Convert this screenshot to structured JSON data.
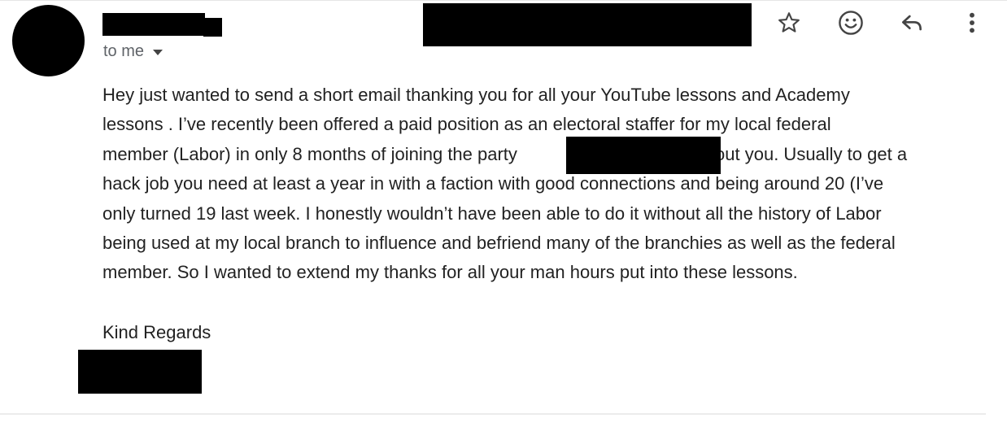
{
  "header": {
    "recipient_label": "to me"
  },
  "toolbar": {
    "star_icon": "star-outline",
    "emoji_icon": "add-reaction-smiley",
    "reply_icon": "reply-arrow",
    "more_icon": "vertical-ellipsis"
  },
  "message": {
    "line1": "Hey just wanted to send a short email thanking you for all your YouTube lessons and Academy",
    "line2": "lessons . I’ve recently been offered a paid position as an electoral staffer for my local federal",
    "line3a": "member (Labor) in only 8 months of joining the party",
    "line3b": "without you. Usually to get a",
    "line4": "hack job you need at least a year in with a faction with good connections and being around 20 (I’ve",
    "line5": "only turned 19 last week. I honestly wouldn’t have been able to do it without all the history of Labor",
    "line6": "being used at my local branch to influence and befriend many of the branchies as well as the federal",
    "line7": "member. So I wanted to extend my thanks for all your man hours put into these lessons.",
    "signoff": "Kind Regards"
  },
  "colors": {
    "text": "#222222",
    "secondary_text": "#5f6368",
    "icon": "#444444",
    "redaction": "#000000"
  }
}
